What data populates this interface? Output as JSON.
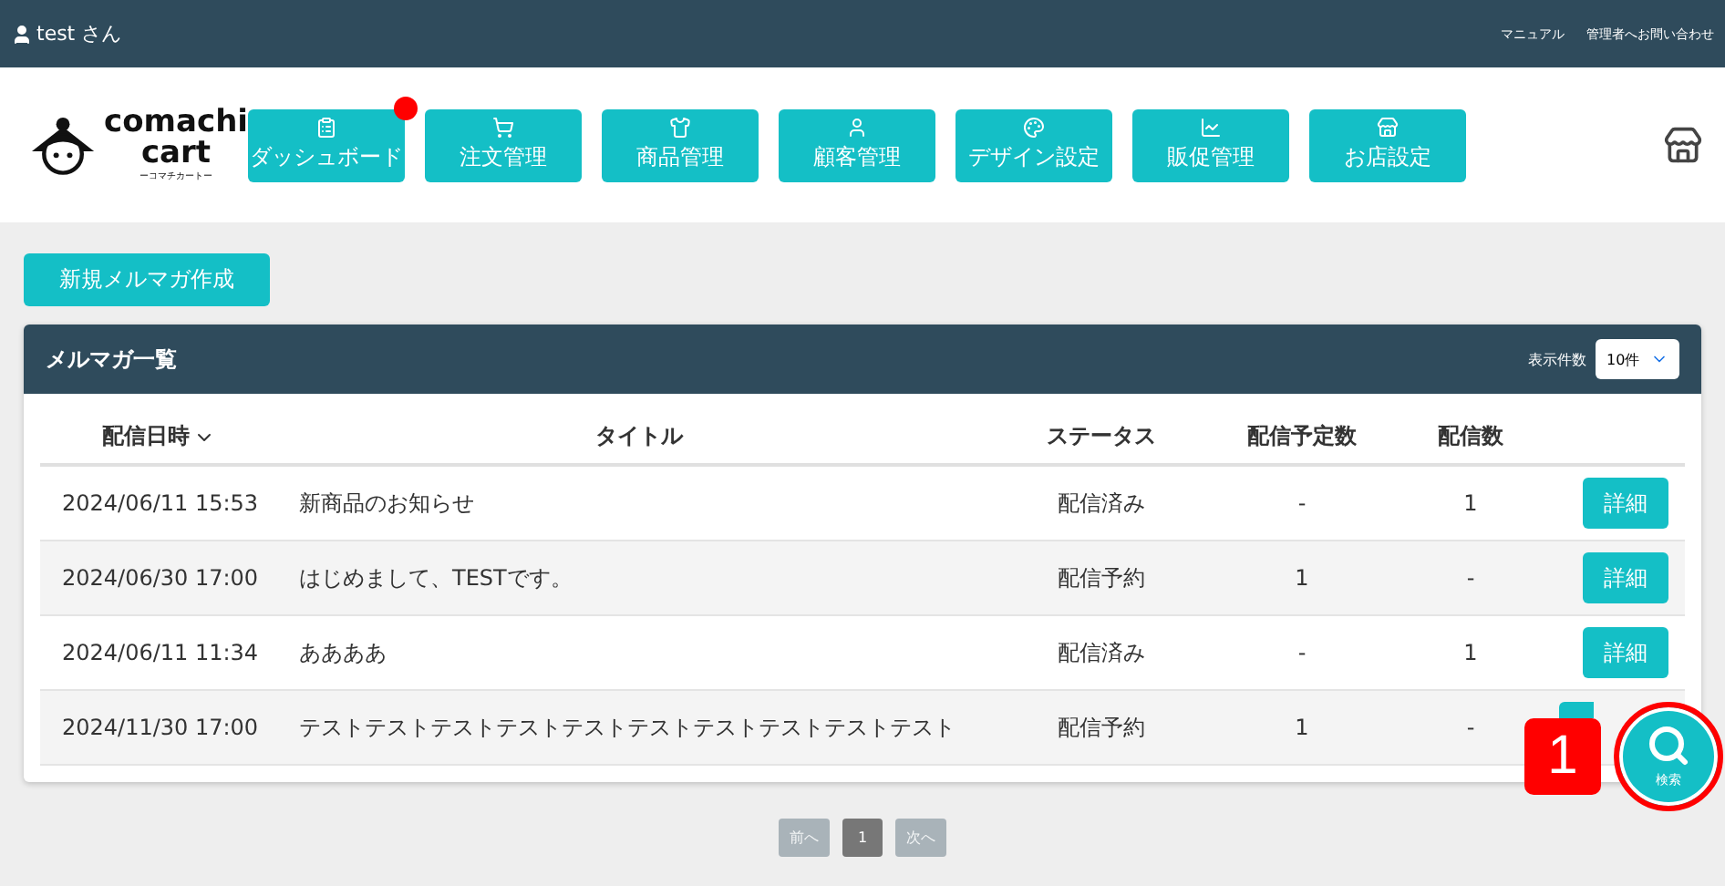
{
  "topbar": {
    "user": "test さん",
    "links": [
      "マニュアル",
      "管理者へお問い合わせ"
    ]
  },
  "logo": {
    "line1": "comachi",
    "line2": "cart",
    "sub": "ーコマチカートー"
  },
  "nav": [
    {
      "label": "ダッシュボード",
      "kind": "clipboard",
      "notify": true
    },
    {
      "label": "注文管理",
      "kind": "cart",
      "notify": false
    },
    {
      "label": "商品管理",
      "kind": "shirt",
      "notify": false
    },
    {
      "label": "顧客管理",
      "kind": "user",
      "notify": false
    },
    {
      "label": "デザイン設定",
      "kind": "palette",
      "notify": false
    },
    {
      "label": "販促管理",
      "kind": "chart",
      "notify": false
    },
    {
      "label": "お店設定",
      "kind": "store",
      "notify": false
    }
  ],
  "new_button": "新規メルマガ作成",
  "panel": {
    "title": "メルマガ一覧",
    "per_page_label": "表示件数",
    "per_page": "10件"
  },
  "table": {
    "columns": [
      "配信日時",
      "タイトル",
      "ステータス",
      "配信予定数",
      "配信数"
    ],
    "rows": [
      {
        "date": "2024/06/11 15:53",
        "title": "新商品のお知らせ",
        "status": "配信済み",
        "planned": "-",
        "sent": "1",
        "action": "詳細"
      },
      {
        "date": "2024/06/30 17:00",
        "title": "はじめまして、TESTです。",
        "status": "配信予約",
        "planned": "1",
        "sent": "-",
        "action": "詳細"
      },
      {
        "date": "2024/06/11 11:34",
        "title": "ああああ",
        "status": "配信済み",
        "planned": "-",
        "sent": "1",
        "action": "詳細"
      },
      {
        "date": "2024/11/30 17:00",
        "title": "テストテストテストテストテストテストテストテストテストテスト",
        "status": "配信予約",
        "planned": "1",
        "sent": "-"
      }
    ]
  },
  "pagination": [
    {
      "label": "前へ",
      "selected": false
    },
    {
      "label": "1",
      "selected": true
    },
    {
      "label": "次へ",
      "selected": false
    }
  ],
  "search_fab": {
    "label": "検索"
  },
  "callout": "1"
}
